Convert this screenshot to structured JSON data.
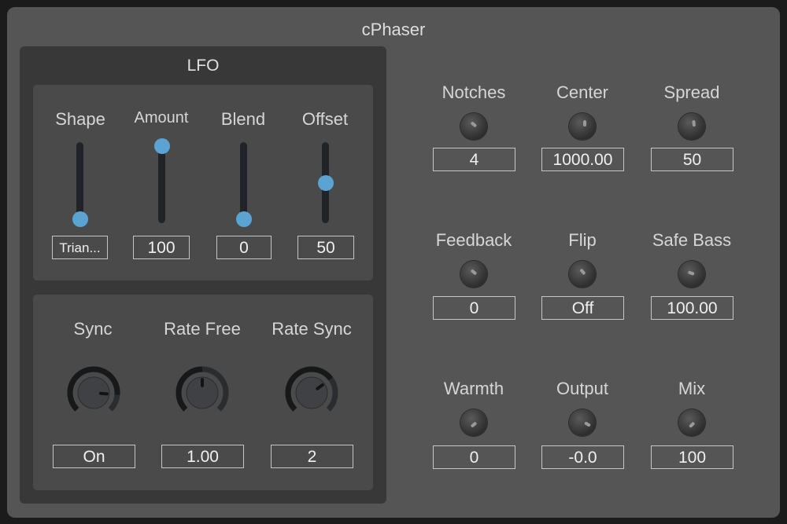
{
  "app": {
    "title": "cPhaser"
  },
  "lfo": {
    "title": "LFO",
    "sliders": [
      {
        "label": "Shape",
        "value": "Trian...",
        "level": 0.0
      },
      {
        "label": "Amount",
        "value": "100",
        "level": 1.0
      },
      {
        "label": "Blend",
        "value": "0",
        "level": 0.0
      },
      {
        "label": "Offset",
        "value": "50",
        "level": 0.5
      }
    ],
    "knobs": [
      {
        "label": "Sync",
        "value": "On",
        "level": 0.85
      },
      {
        "label": "Rate Free",
        "value": "1.00",
        "level": 0.5
      },
      {
        "label": "Rate Sync",
        "value": "2",
        "level": 0.7
      }
    ]
  },
  "params": [
    {
      "label": "Notches",
      "value": "4",
      "angle": -140
    },
    {
      "label": "Center",
      "value": "1000.00",
      "angle": -90
    },
    {
      "label": "Spread",
      "value": "50",
      "angle": -95
    },
    {
      "label": "Feedback",
      "value": "0",
      "angle": -140
    },
    {
      "label": "Flip",
      "value": "Off",
      "angle": -130
    },
    {
      "label": "Safe Bass",
      "value": "100.00",
      "angle": -160
    },
    {
      "label": "Warmth",
      "value": "0",
      "angle": 140
    },
    {
      "label": "Output",
      "value": "-0.0",
      "angle": 30
    },
    {
      "label": "Mix",
      "value": "100",
      "angle": 135
    }
  ],
  "colors": {
    "background": "#555555",
    "panel": "#383838",
    "subpanel": "#4a4a4a",
    "accent": "#5ba3d2",
    "track": "#202428"
  }
}
